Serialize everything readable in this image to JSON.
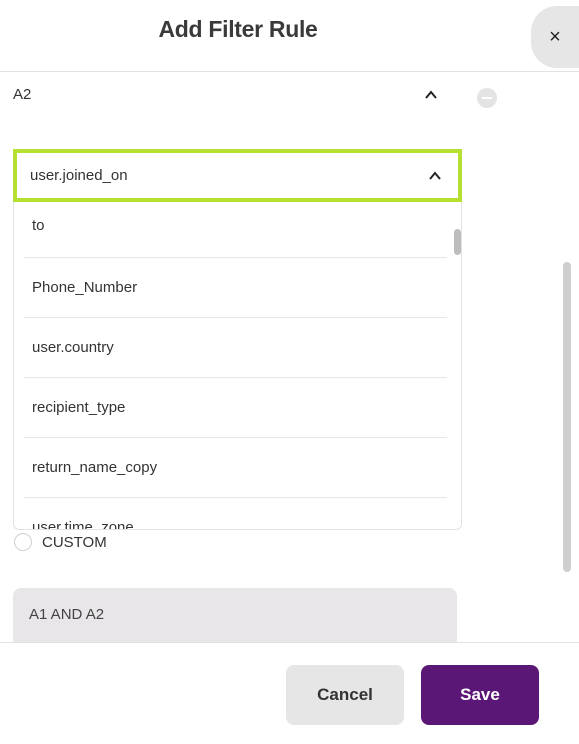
{
  "header": {
    "title": "Add Filter Rule",
    "close_label": "×"
  },
  "rule": {
    "label": "A2"
  },
  "select": {
    "value": "user.joined_on"
  },
  "options": [
    "to",
    "Phone_Number",
    "user.country",
    "recipient_type",
    "return_name_copy",
    "user.time_zone"
  ],
  "custom": {
    "label": "CUSTOM"
  },
  "expression": {
    "text": "A1 AND A2"
  },
  "footer": {
    "cancel_label": "Cancel",
    "save_label": "Save"
  },
  "colors": {
    "accent_purple": "#5b1776",
    "focus_green": "#b5e02f"
  }
}
